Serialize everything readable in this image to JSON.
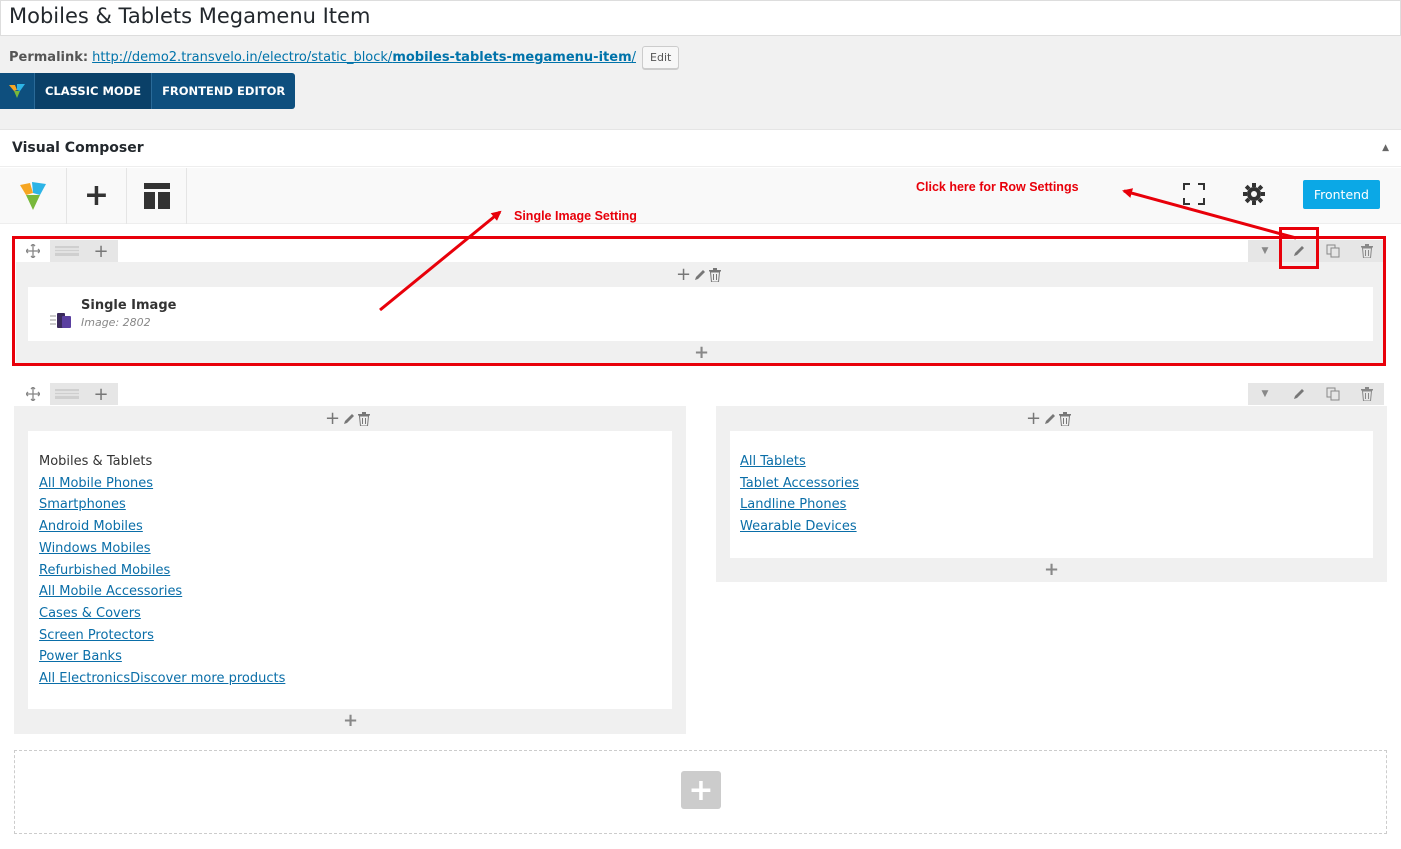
{
  "post": {
    "title": "Mobiles & Tablets Megamenu Item"
  },
  "permalink": {
    "label": "Permalink:",
    "url_base": "http://demo2.transvelo.in/electro/static_block/",
    "url_slug": "mobiles-tablets-megamenu-item",
    "url_end": "/",
    "edit_label": "Edit"
  },
  "mode_bar": {
    "classic_label": "CLASSIC MODE",
    "frontend_editor_label": "FRONTEND EDITOR"
  },
  "vc": {
    "title": "Visual Composer",
    "frontend_label": "Frontend"
  },
  "annotations": {
    "row_settings": "Click here for Row Settings",
    "single_image": "Single Image Setting"
  },
  "row1": {
    "element_title": "Single Image",
    "element_subtitle": "Image: 2802"
  },
  "row2": {
    "left": {
      "heading": "Mobiles & Tablets",
      "links": [
        "All Mobile Phones",
        "Smartphones",
        "Android Mobiles",
        "Windows Mobiles",
        "Refurbished Mobiles",
        "All Mobile Accessories",
        "Cases & Covers",
        "Screen Protectors",
        "Power Banks",
        "All ElectronicsDiscover more products"
      ]
    },
    "right": {
      "links": [
        "All Tablets",
        "Tablet Accessories",
        "Landline Phones",
        "Wearable Devices"
      ]
    }
  },
  "colors": {
    "accent": "#0ba8e6",
    "annotation": "#e8000a",
    "mode_bar": "#0e4f7e",
    "link": "#0a6ea8"
  }
}
